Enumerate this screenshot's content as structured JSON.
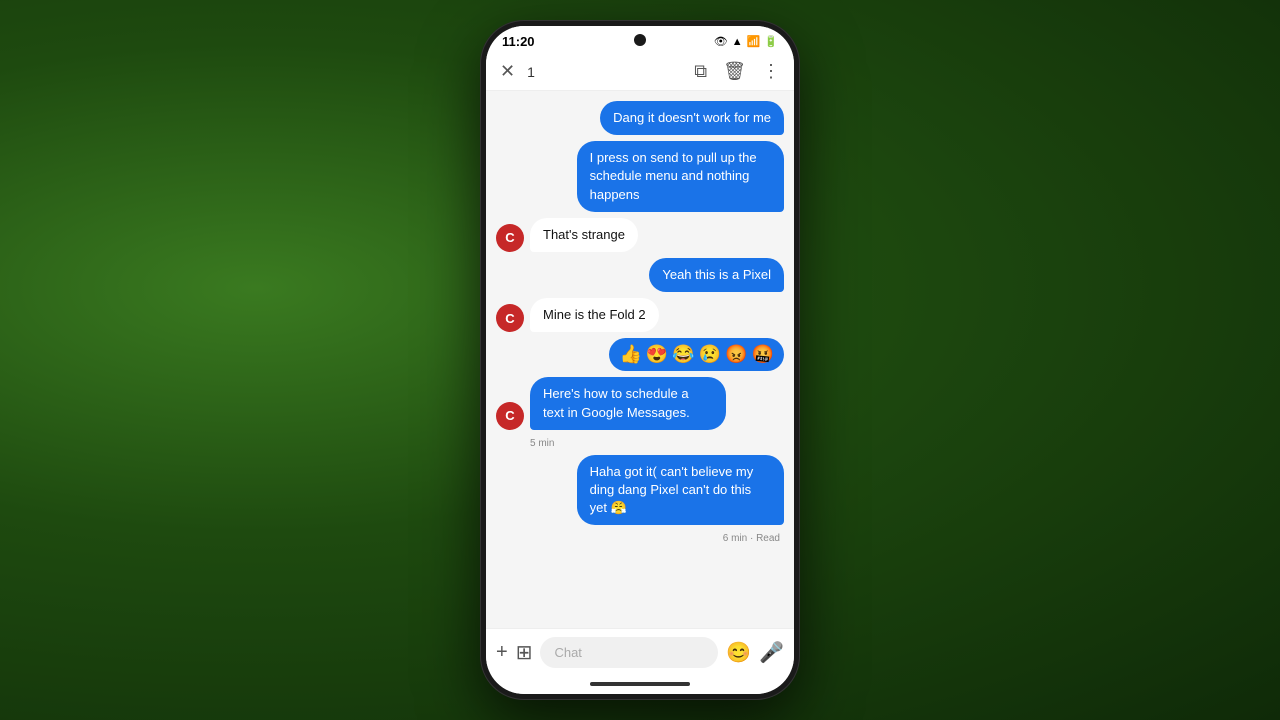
{
  "status": {
    "time": "11:20",
    "icons": "👁 ▲ ▼ 📶 🔋"
  },
  "action_bar": {
    "close_label": "✕",
    "count": "1",
    "copy_icon": "⧉",
    "delete_icon": "🗑",
    "more_icon": "⋮"
  },
  "messages": [
    {
      "id": 1,
      "type": "sent",
      "text": "Dang it doesn't work for me"
    },
    {
      "id": 2,
      "type": "sent",
      "text": "I press on send to pull up the schedule menu and nothing happens"
    },
    {
      "id": 3,
      "type": "recv",
      "avatar": "C",
      "text": "That's strange"
    },
    {
      "id": 4,
      "type": "sent",
      "text": "Yeah this is a Pixel"
    },
    {
      "id": 5,
      "type": "recv",
      "avatar": "C",
      "text": "Mine is the Fold 2"
    },
    {
      "id": 6,
      "type": "reaction",
      "emojis": [
        "👍",
        "😍",
        "😂",
        "😢",
        "😡",
        "🤬"
      ]
    },
    {
      "id": 7,
      "type": "recv_blue",
      "avatar": "C",
      "text": "Here's how to schedule a text in Google Messages.",
      "meta": "5 min"
    },
    {
      "id": 8,
      "type": "sent",
      "text": "Haha got it( can't believe my ding dang Pixel can't do this yet 😤",
      "meta": "6 min · Read"
    }
  ],
  "input": {
    "placeholder": "Chat",
    "add_icon": "+",
    "attach_icon": "⊞",
    "emoji_icon": "😊",
    "voice_icon": "🎤"
  }
}
